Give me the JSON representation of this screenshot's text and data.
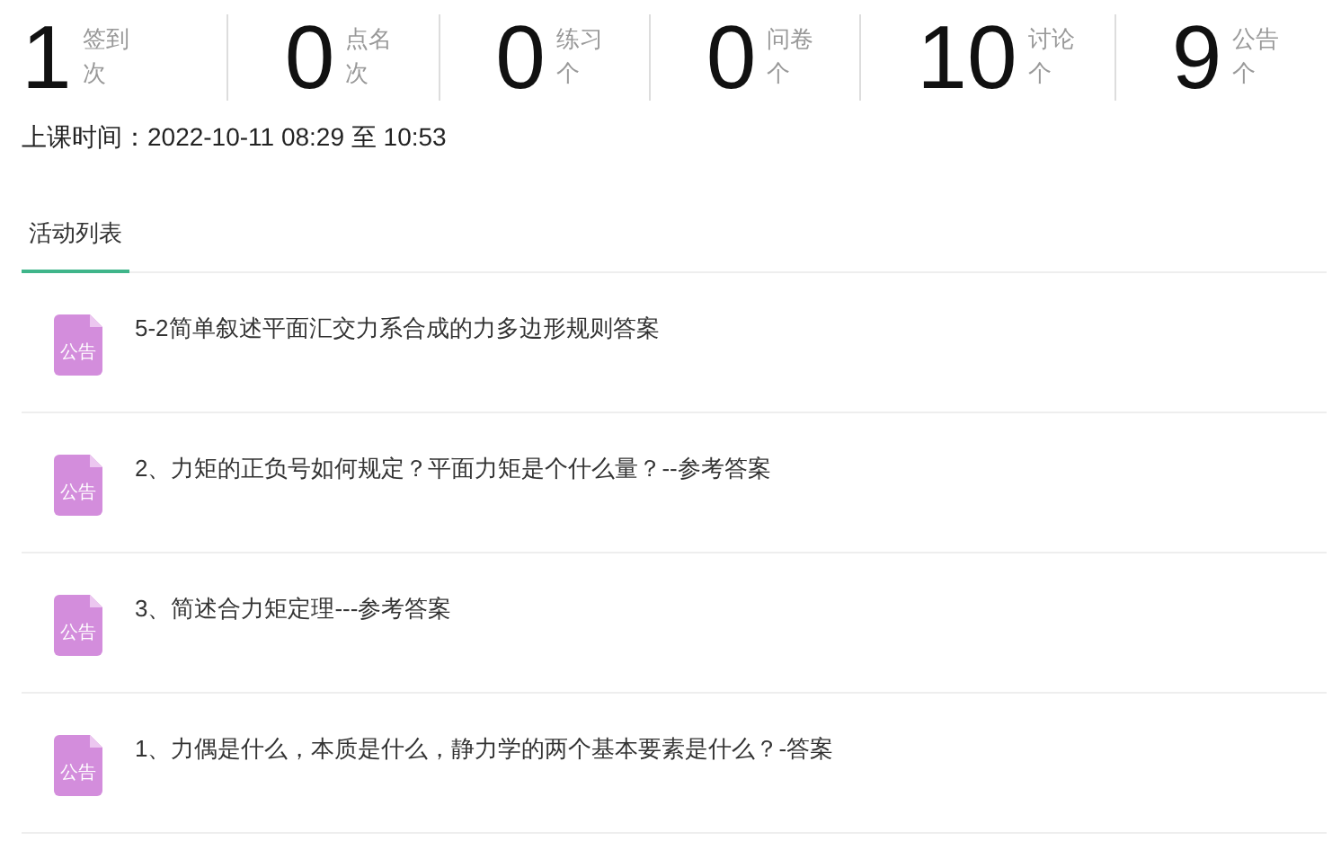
{
  "stats": [
    {
      "value": "1",
      "label": "签到",
      "unit": "次"
    },
    {
      "value": "0",
      "label": "点名",
      "unit": "次"
    },
    {
      "value": "0",
      "label": "练习",
      "unit": "个"
    },
    {
      "value": "0",
      "label": "问卷",
      "unit": "个"
    },
    {
      "value": "10",
      "label": "讨论",
      "unit": "个"
    },
    {
      "value": "9",
      "label": "公告",
      "unit": "个"
    }
  ],
  "class_time": "上课时间：2022-10-11 08:29 至 10:53",
  "tabs": [
    {
      "label": "活动列表",
      "selected": true
    }
  ],
  "activities": [
    {
      "badge": "公告",
      "title": "5-2简单叙述平面汇交力系合成的力多边形规则答案"
    },
    {
      "badge": "公告",
      "title": "2、力矩的正负号如何规定？平面力矩是个什么量？--参考答案"
    },
    {
      "badge": "公告",
      "title": "3、简述合力矩定理---参考答案"
    },
    {
      "badge": "公告",
      "title": "1、力偶是什么，本质是什么，静力学的两个基本要素是什么？-答案"
    }
  ]
}
